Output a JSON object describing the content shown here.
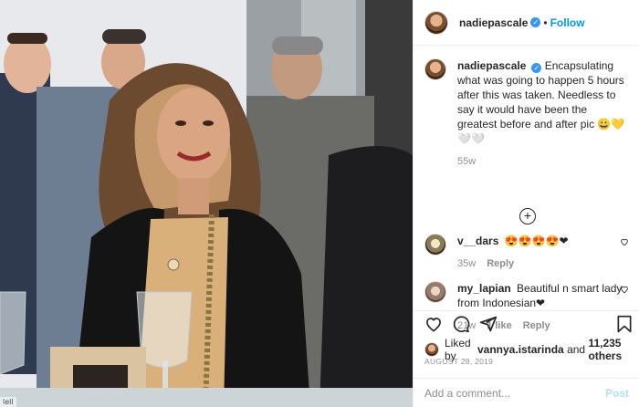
{
  "photo": {
    "corner_text": "lell"
  },
  "post": {
    "username": "nadiepascale",
    "separator": "•",
    "follow_label": "Follow",
    "caption": "Encapsulating what was going to happen 5 hours after this was taken. Needless to say it would have been the greatest before and after pic 😀💛🤍🤍",
    "caption_age": "55w",
    "comments": [
      {
        "username": "v__dars",
        "text": "😍😍😍😍❤",
        "age": "35w",
        "likes": "",
        "reply_label": "Reply"
      },
      {
        "username": "my_lapian",
        "text": "Beautiful n smart lady from Indonesian❤",
        "age": "21w",
        "likes": "1 like",
        "reply_label": "Reply"
      }
    ],
    "liked_by_prefix": "Liked by ",
    "liked_by_user": "vannya.istarinda",
    "liked_by_and": " and ",
    "liked_by_others": "11,235 others",
    "date": "AUGUST 28, 2019",
    "add_comment_placeholder": "Add a comment...",
    "post_label": "Post"
  },
  "colors": {
    "accent": "#0095f6",
    "verified": "#3897f0",
    "muted": "#8e8e8e",
    "post_disabled": "#b2dffc"
  }
}
